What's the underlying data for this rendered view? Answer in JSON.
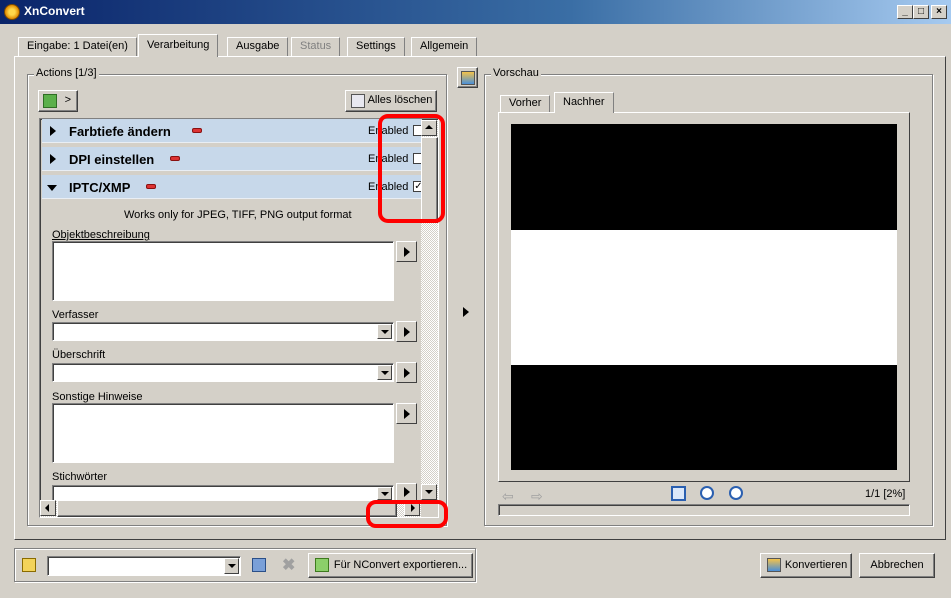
{
  "window": {
    "title": "XnConvert",
    "minimize": "_",
    "maximize": "□",
    "close": "×"
  },
  "tabs": [
    {
      "label": "Eingabe: 1 Datei(en)"
    },
    {
      "label": "Verarbeitung"
    },
    {
      "label": "Ausgabe"
    },
    {
      "label": "Status"
    },
    {
      "label": "Settings"
    },
    {
      "label": "Allgemein"
    }
  ],
  "actions": {
    "group_label": "Actions [1/3]",
    "add_button": ">",
    "clear_button": "Alles löschen",
    "items": [
      {
        "label": "Farbtiefe ändern",
        "enabled_label": "Enabled",
        "checked": ""
      },
      {
        "label": "DPI einstellen",
        "enabled_label": "Enabled",
        "checked": ""
      },
      {
        "label": "IPTC/XMP",
        "enabled_label": "Enabled",
        "checked": "✓"
      }
    ],
    "note": "Works only for JPEG, TIFF, PNG output format",
    "fields": {
      "objektbeschreibung": "Objektbeschreibung",
      "verfasser": "Verfasser",
      "ueberschrift": "Überschrift",
      "sonstige": "Sonstige Hinweise",
      "stichwoerter": "Stichwörter"
    }
  },
  "preview": {
    "group_label": "Vorschau",
    "tabs": [
      "Vorher",
      "Nachher"
    ],
    "page_info": "1/1 [2%]"
  },
  "bottom": {
    "export_button": "Für NConvert exportieren...",
    "convert_button": "Konvertieren",
    "cancel_button": "Abbrechen"
  },
  "colors": {
    "annotation": "#ff0000",
    "action_row": "#c7d8ea"
  }
}
